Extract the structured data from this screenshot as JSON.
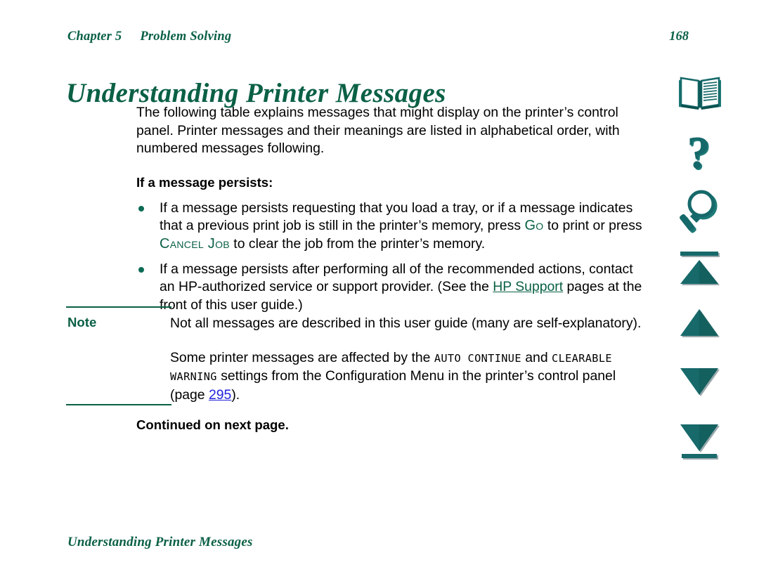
{
  "running_head": {
    "chapter": "Chapter 5",
    "section": "Problem Solving",
    "page_number": "168"
  },
  "page_title": "Understanding Printer Messages",
  "intro": {
    "paragraph": "The following table explains messages that might display on the printer’s control panel. Printer messages and their meanings are listed in alphabetical order, with numbered messages following."
  },
  "subhead": "If a message persists:",
  "bullets": [
    {
      "part1": "If a message persists requesting that you load a tray, or if a message indicates that a previous print job is still in the printer’s memory, press ",
      "key1": "Go",
      "part2": " to print or press ",
      "key2": "Cancel Job",
      "part3": " to clear the job from the printer’s memory."
    },
    {
      "part1": "If a message persists after performing all of the recommended actions, contact an HP-authorized service or support provider. (See the ",
      "link": "HP Support",
      "part2": " pages at the front of this user guide.)"
    }
  ],
  "note": {
    "label": "Note",
    "paragraph1": "Not all messages are described in this user guide (many are self-explanatory).",
    "paragraph2_part1": "Some printer messages are affected by the ",
    "paragraph2_setting1": "AUTO CONTINUE",
    "paragraph2_part2": " and ",
    "paragraph2_setting2": "CLEARABLE WARNING",
    "paragraph2_part3": " settings from the Configuration Menu in the printer’s control panel (page ",
    "paragraph2_pagelink": "295",
    "paragraph2_part4": ")."
  },
  "continued": "Continued on next page.",
  "footer": "Understanding Printer Messages",
  "nav_icons": [
    {
      "name": "table-of-contents",
      "glyph": "open-book"
    },
    {
      "name": "help",
      "glyph": "question-mark"
    },
    {
      "name": "search",
      "glyph": "magnifier"
    },
    {
      "name": "first-page",
      "glyph": "triangle-up-bar"
    },
    {
      "name": "previous-page",
      "glyph": "triangle-up"
    },
    {
      "name": "next-page",
      "glyph": "triangle-down"
    },
    {
      "name": "last-page",
      "glyph": "triangle-down-bar"
    }
  ],
  "colors": {
    "heading_green": "#0a6045",
    "icon_teal": "#16696a",
    "link_blue": "#2222dd",
    "bullet": "#0c6b55"
  }
}
